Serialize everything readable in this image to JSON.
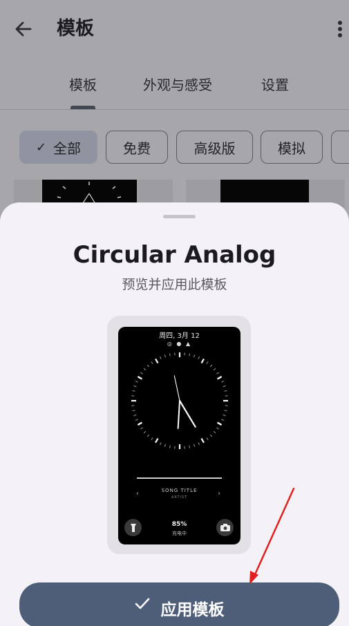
{
  "header": {
    "title": "模板"
  },
  "tabs": [
    {
      "label": "模板",
      "selected": true
    },
    {
      "label": "外观与感受",
      "selected": false
    },
    {
      "label": "设置",
      "selected": false
    }
  ],
  "filter_chips": [
    {
      "label": "全部",
      "selected": true
    },
    {
      "label": "免费",
      "selected": false
    },
    {
      "label": "高级版",
      "selected": false
    },
    {
      "label": "模拟",
      "selected": false
    }
  ],
  "sheet": {
    "title": "Circular Analog",
    "subtitle": "预览并应用此模板",
    "preview": {
      "date": "周四, 3月 12",
      "status_icons": [
        "whatsapp-icon",
        "alarm-icon",
        "bell-icon"
      ],
      "song_title": "SONG TITLE",
      "artist": "ARTIST",
      "battery": "85%",
      "charging": "充电中",
      "clock_hour": 4,
      "clock_minute": 58
    },
    "apply_label": "应用模板"
  },
  "colors": {
    "scrim": "#a7a6aa",
    "sheet_bg": "#f4f2f6",
    "button": "#4f5e78",
    "chip_selected": "#8f94a0",
    "annotation_arrow": "#e02020"
  }
}
